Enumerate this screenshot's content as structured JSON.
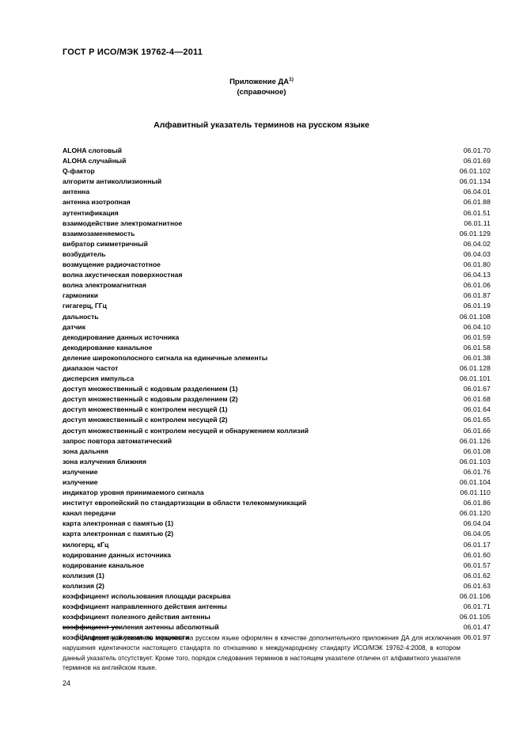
{
  "document": {
    "header": "ГОСТ Р ИСО/МЭК 19762-4—2011",
    "annex_title": "Приложение ДА",
    "annex_footnote_marker": "1)",
    "annex_subtitle": "(справочное)",
    "index_title": "Алфавитный указатель терминов на русском языке",
    "page_number": "24"
  },
  "index_entries": [
    {
      "term": "ALOHA слотовый",
      "code": "06.01.70"
    },
    {
      "term": "ALOHA случайный",
      "code": "06.01.69"
    },
    {
      "term": "Q-фактор",
      "code": "06.01.102"
    },
    {
      "term": "алгоритм антиколлизионный",
      "code": "06.01.134"
    },
    {
      "term": "антенна",
      "code": "06.04.01"
    },
    {
      "term": "антенна изотропная",
      "code": "06.01.88"
    },
    {
      "term": "аутентификация",
      "code": "06.01.51"
    },
    {
      "term": "взаимодействие электромагнитное",
      "code": "06.01.11"
    },
    {
      "term": "взаимозаменяемость",
      "code": "06.01.129"
    },
    {
      "term": "вибратор симметричный",
      "code": "06.04.02"
    },
    {
      "term": "возбудитель",
      "code": "06.04.03"
    },
    {
      "term": "возмущение радиочастотное",
      "code": "06.01.80"
    },
    {
      "term": "волна акустическая поверхностная",
      "code": "06.04.13"
    },
    {
      "term": "волна электромагнитная",
      "code": "06.01.06"
    },
    {
      "term": "гармоники",
      "code": "06.01.87"
    },
    {
      "term": "гигагерц, ГГц",
      "code": "06.01.19"
    },
    {
      "term": "дальность",
      "code": "06.01.108"
    },
    {
      "term": "датчик",
      "code": "06.04.10"
    },
    {
      "term": "декодирование данных источника",
      "code": "06.01.59"
    },
    {
      "term": "декодирование канальное",
      "code": "06.01.58"
    },
    {
      "term": "деление широкополосного сигнала на единичные элементы",
      "code": "06.01.38"
    },
    {
      "term": "диапазон частот",
      "code": "06.01.128"
    },
    {
      "term": "дисперсия импульса",
      "code": "06.01.101"
    },
    {
      "term": "доступ множественный с кодовым разделением (1)",
      "code": "06.01.67"
    },
    {
      "term": "доступ множественный с кодовым разделением (2)",
      "code": "06.01.68"
    },
    {
      "term": "доступ множественный с контролем несущей (1)",
      "code": "06.01.64"
    },
    {
      "term": "доступ множественный с контролем несущей (2)",
      "code": "06.01.65"
    },
    {
      "term": "доступ множественный с контролем несущей и обнаружением коллизий",
      "code": "06.01.66"
    },
    {
      "term": "запрос повтора автоматический",
      "code": "06.01.126"
    },
    {
      "term": "зона дальняя",
      "code": "06.01.08"
    },
    {
      "term": "зона излучения ближняя",
      "code": "06.01.103"
    },
    {
      "term": "излучение",
      "code": "06.01.76"
    },
    {
      "term": "излучение",
      "code": "06.01.104"
    },
    {
      "term": "индикатор уровня принимаемого сигнала",
      "code": "06.01.110"
    },
    {
      "term": "институт европейский по стандартизации в области телекоммуникаций",
      "code": "06.01.86"
    },
    {
      "term": "канал передачи",
      "code": "06.01.120"
    },
    {
      "term": "карта электронная с памятью (1)",
      "code": "06.04.04"
    },
    {
      "term": "карта электронная с памятью (2)",
      "code": "06.04.05"
    },
    {
      "term": "килогерц, кГц",
      "code": "06.01.17"
    },
    {
      "term": "кодирование данных источника",
      "code": "06.01.60"
    },
    {
      "term": "кодирование канальное",
      "code": "06.01.57"
    },
    {
      "term": "коллизия (1)",
      "code": "06.01.62"
    },
    {
      "term": "коллизия (2)",
      "code": "06.01.63"
    },
    {
      "term": "коэффициент использования площади раскрыва",
      "code": "06.01.106"
    },
    {
      "term": "коэффициент направленного действия антенны",
      "code": "06.01.71"
    },
    {
      "term": "коэффициент полезного действия антенны",
      "code": "06.01.105"
    },
    {
      "term": "коэффициент усиления антенны абсолютный",
      "code": "06.01.47"
    },
    {
      "term": "коэффициент усиления по мощности",
      "code": "06.01.97"
    }
  ],
  "footnote": {
    "marker": "1)",
    "text": "Алфавитный указатель терминов на русском языке оформлен в качестве дополнительного приложения ДА для исключения нарушения идентичности настоящего стандарта по отношению к международному стандарту ИСО/МЭК 19762-4:2008, в котором данный указатель отсутствует. Кроме того, порядок следования терминов в настоящем указателе отличен от алфавитного указателя терминов на английском языке."
  }
}
